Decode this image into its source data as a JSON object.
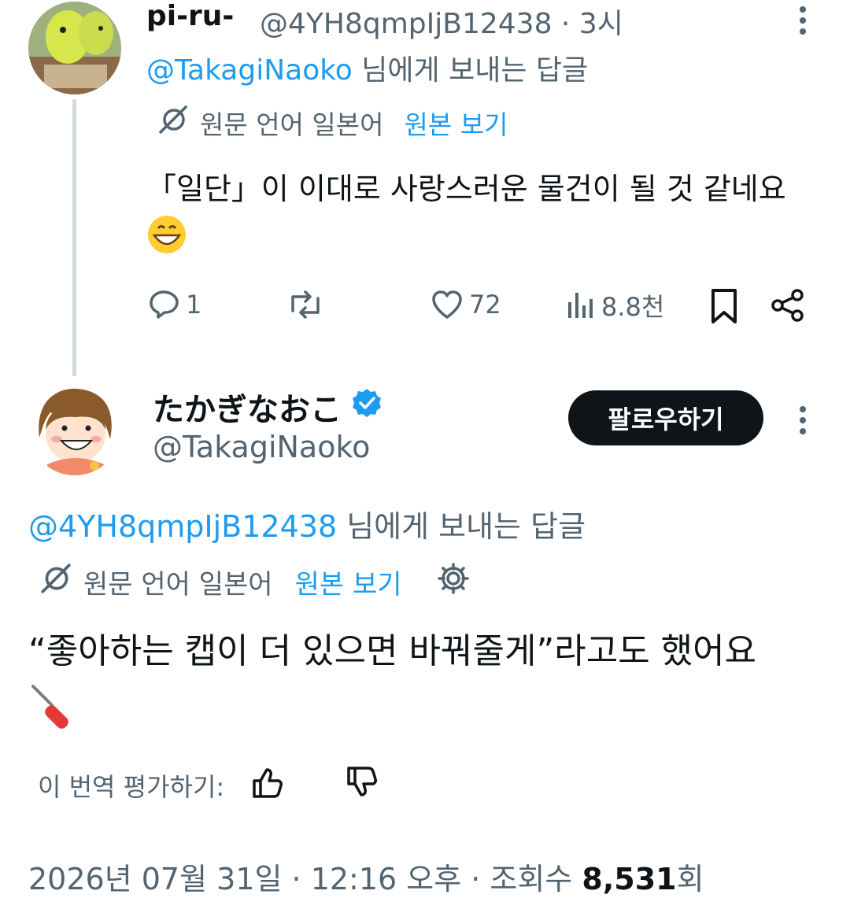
{
  "reply": {
    "name": "pi-ru-",
    "handle": "@4YH8qmpIjB12438",
    "time": "3시",
    "reply_to_handle": "@TakagiNaoko",
    "reply_to_suffix": " 님에게 보내는 답글",
    "translation_label": "원문 언어 일본어",
    "view_original": "원본 보기",
    "text": "「일단」이 이대로 사랑스러운 물건이 될 것 같네요",
    "text_emoji": "grinning-face-emoji",
    "replies": "1",
    "likes": "72",
    "views": "8.8천"
  },
  "tweet": {
    "name": "たかぎなおこ",
    "verified": true,
    "handle": "@TakagiNaoko",
    "follow_label": "팔로우하기",
    "reply_to_handle": "@4YH8qmpIjB12438",
    "reply_to_suffix": " 님에게 보내는 답글",
    "translation_label": "원문 언어 일본어",
    "view_original": "원본 보기",
    "text": "“좋아하는 캡이 더 있으면 바꿔줄게”라고도 했어요",
    "text_emoji": "screwdriver-emoji",
    "rate_label": "이 번역 평가하기:",
    "date": "2026년 07월 31일 · 12:16 오후 · 조회수 ",
    "view_count": "8,531",
    "view_suffix": "회"
  },
  "colors": {
    "accent": "#1d9bf0",
    "muted": "#536471",
    "text": "#0f1419",
    "thread": "#cfd9de"
  }
}
